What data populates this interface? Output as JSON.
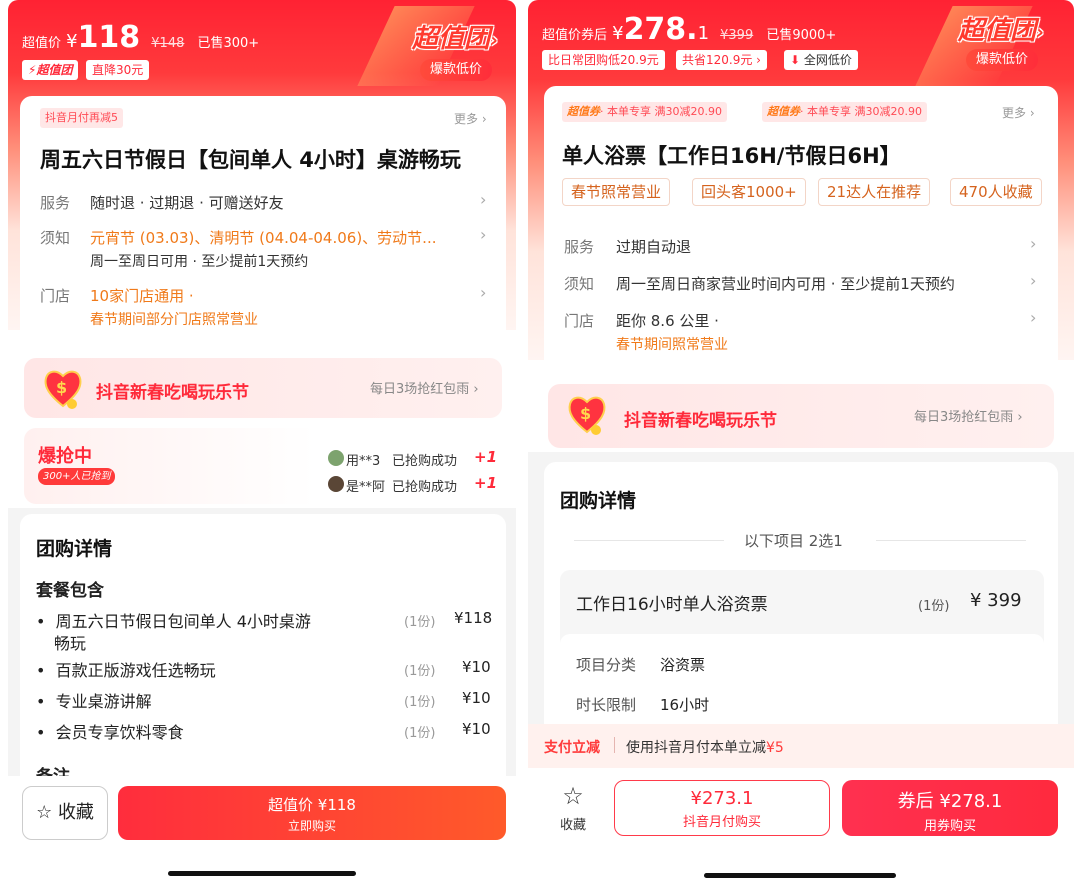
{
  "left": {
    "price_label": "超值价",
    "currency": "¥",
    "price": "118",
    "original_price": "¥148",
    "sold": "已售300+",
    "brand_chip": "超值团",
    "drop_chip": "直降30元",
    "brand": "超值团",
    "brand_arrow": "›",
    "brand_sub": "爆款低价",
    "promo_tag": "抖音月付再减5",
    "more": "更多 ›",
    "title": "周五六日节假日【包间单人 4小时】桌游畅玩",
    "service_label": "服务",
    "service_text": "随时退 · 过期退 · 可赠送好友",
    "notice_label": "须知",
    "notice_text_1": "元宵节 (03.03)、清明节 (04.04-04.06)、劳动节...",
    "notice_text_2": "周一至周日可用 · 至少提前1天预约",
    "store_label": "门店",
    "store_text": "10家门店通用 ·",
    "store_text_2": "春节期间部分门店照常营业",
    "festival_title": "抖音新春吃喝玩乐节",
    "festival_right": "每日3场抢红包雨 ›",
    "hot_title": "爆抢中",
    "hot_badge": "300+人已抢到",
    "buyer1_name": "用**3",
    "buyer1_status": "已抢购成功",
    "buyer1_plus": "+1",
    "buyer2_name": "是**阿",
    "buyer2_status": "已抢购成功",
    "buyer2_plus": "+1",
    "detail_title": "团购详情",
    "package_title": "套餐包含",
    "packages": [
      {
        "name1": "周五六日节假日包间单人 4小时桌游",
        "name2": "畅玩",
        "count": "(1份)",
        "price": "¥118"
      },
      {
        "name1": "百款正版游戏任选畅玩",
        "count": "(1份)",
        "price": "¥10"
      },
      {
        "name1": "专业桌游讲解",
        "count": "(1份)",
        "price": "¥10"
      },
      {
        "name1": "会员专享饮料零食",
        "count": "(1份)",
        "price": "¥10"
      }
    ],
    "remark_cut": "备注",
    "fav_label": "收藏",
    "buy_price": "超值价 ¥118",
    "buy_label": "立即购买"
  },
  "right": {
    "price_label": "超值价券后",
    "currency": "¥",
    "price": "278.",
    "price_dec": "1",
    "original_price": "¥399",
    "sold": "已售9000+",
    "chip1": "比日常团购低20.9元",
    "chip2": "共省120.9元 ›",
    "chip3": "全网低价",
    "brand": "超值团",
    "brand_arrow": "›",
    "brand_sub": "爆款低价",
    "coupon1_name": "超值券",
    "coupon1_text": "· 本单专享  满30减20.90",
    "coupon2_name": "超值券",
    "coupon2_text": "· 本单专享  满30减20.90",
    "more": "更多 ›",
    "title": "单人浴票【工作日16H/节假日6H】",
    "tags": [
      "春节照常营业",
      "回头客1000+",
      "21达人在推荐",
      "470人收藏"
    ],
    "service_label": "服务",
    "service_text": "过期自动退",
    "notice_label": "须知",
    "notice_text": "周一至周日商家营业时间内可用 · 至少提前1天预约",
    "store_label": "门店",
    "store_text": "距你 8.6 公里 ·",
    "store_text_2": "春节期间照常营业",
    "festival_title": "抖音新春吃喝玩乐节",
    "festival_right": "每日3场抢红包雨 ›",
    "detail_title": "团购详情",
    "choose_text": "以下项目 2选1",
    "item_title": "工作日16小时单人浴资票",
    "item_count": "(1份)",
    "item_price": "¥ 399",
    "cat_label": "项目分类",
    "cat_value": "浴资票",
    "dur_label": "时长限制",
    "dur_value": "16小时",
    "pay_tag": "支付立减",
    "pay_text": "使用抖音月付本单立减",
    "pay_amount": "¥5",
    "fav_label": "收藏",
    "btn1_price": "¥273.1",
    "btn1_label": "抖音月付购买",
    "btn2_price": "券后 ¥278.1",
    "btn2_label": "用券购买"
  }
}
